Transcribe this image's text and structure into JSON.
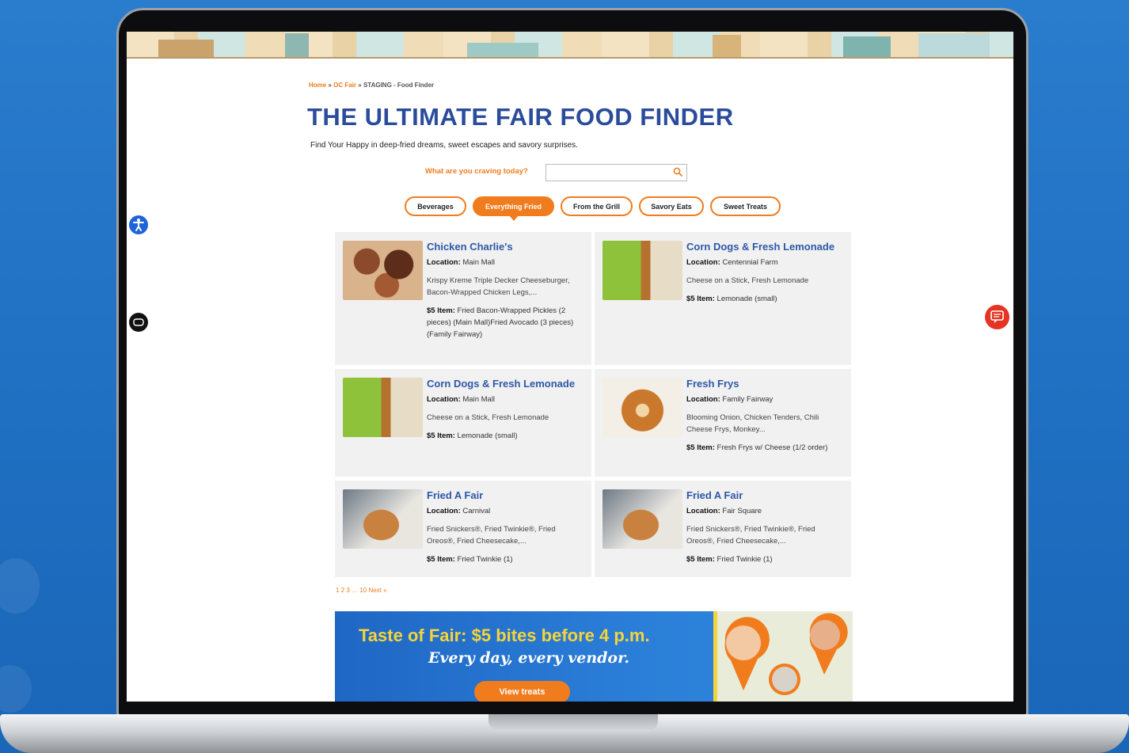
{
  "breadcrumb": {
    "home": "Home",
    "sep1": " » ",
    "parent": "OC Fair",
    "sep2": " » ",
    "current": "STAGING - Food Finder"
  },
  "page": {
    "title": "THE ULTIMATE FAIR FOOD FINDER",
    "tagline": "Find Your Happy in deep-fried dreams, sweet escapes and savory surprises."
  },
  "search": {
    "label": "What are you craving today?",
    "value": "",
    "placeholder": ""
  },
  "tabs": [
    {
      "label": "Beverages",
      "active": false
    },
    {
      "label": "Everything Fried",
      "active": true
    },
    {
      "label": "From the Grill",
      "active": false
    },
    {
      "label": "Savory Eats",
      "active": false
    },
    {
      "label": "Sweet Treats",
      "active": false
    }
  ],
  "labels": {
    "location": "Location:",
    "five_item": "$5 Item:"
  },
  "cards": [
    {
      "title": "Chicken Charlie's",
      "location": "Main Mall",
      "description": "Krispy Kreme Triple Decker Cheeseburger, Bacon-Wrapped Chicken Legs,...",
      "five_item": "Fried Bacon-Wrapped Pickles (2 pieces) (Main Mall)Fried Avocado (3 pieces) (Family Fairway)",
      "image": "fried-donut-burgers"
    },
    {
      "title": "Corn Dogs & Fresh Lemonade",
      "location": "Centennial Farm",
      "description": "Cheese on a Stick, Fresh Lemonade",
      "five_item": "Lemonade (small)",
      "image": "corn-dog-lemonade"
    },
    {
      "title": "Corn Dogs & Fresh Lemonade",
      "location": "Main Mall",
      "description": "Cheese on a Stick, Fresh Lemonade",
      "five_item": "Lemonade (small)",
      "image": "corn-dog-lemonade"
    },
    {
      "title": "Fresh Frys",
      "location": "Family Fairway",
      "description": "Blooming Onion, Chicken Tenders, Chili Cheese Frys, Monkey...",
      "five_item": "Fresh Frys w/ Cheese (1/2 order)",
      "image": "blooming-onion"
    },
    {
      "title": "Fried A Fair",
      "location": "Carnival",
      "description": "Fried Snickers®, Fried Twinkie®, Fried Oreos®, Fried Cheesecake,...",
      "five_item": "Fried Twinkie (1)",
      "image": "fried-twinkie"
    },
    {
      "title": "Fried A Fair",
      "location": "Fair Square",
      "description": "Fried Snickers®, Fried Twinkie®, Fried Oreos®, Fried Cheesecake,...",
      "five_item": "Fried Twinkie (1)",
      "image": "fried-twinkie"
    }
  ],
  "pagination": {
    "p1": "1",
    "p2": "2",
    "p3": "3",
    "dots": "…",
    "last": "10",
    "next": "Next »"
  },
  "promo": {
    "title": "Taste of Fair: $5 bites before 4 p.m.",
    "subtitle": "Every day, every vendor.",
    "button": "View treats"
  },
  "colors": {
    "accent": "#f07c1e",
    "title_blue": "#2a4c9b",
    "card_title_blue": "#2e58a8",
    "background_blue": "#2a7ccd"
  },
  "icons": {
    "accessibility": "accessibility-icon",
    "captions": "cc-icon",
    "chat": "chat-icon",
    "search": "search-icon"
  }
}
